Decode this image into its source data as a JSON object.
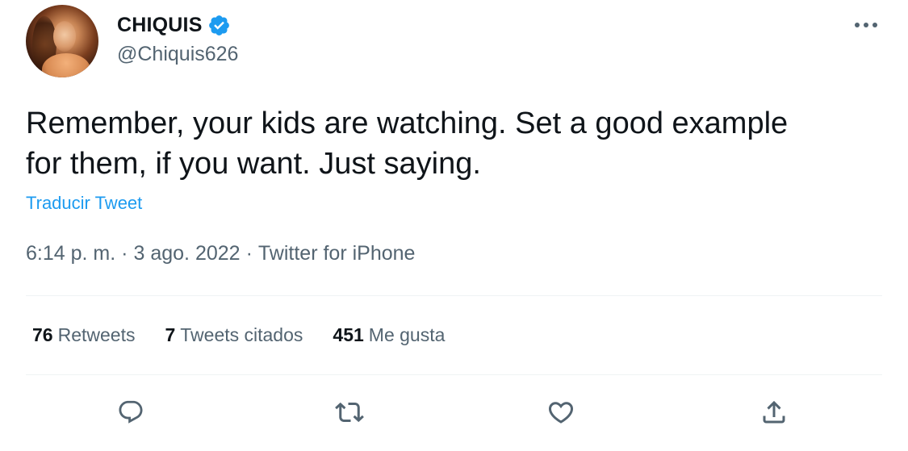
{
  "author": {
    "display_name": "CHIQUIS",
    "handle": "@Chiquis626",
    "verified": true,
    "avatar": "profile-photo"
  },
  "tweet": {
    "text": "Remember, your kids are watching. Set a good example\nfor them, if you want. Just saying.",
    "translate_label": "Traducir Tweet",
    "time": "6:14 p. m.",
    "separator": "·",
    "date": "3 ago. 2022",
    "source": "Twitter for iPhone"
  },
  "stats": {
    "retweets": {
      "count": "76",
      "label": "Retweets"
    },
    "quotes": {
      "count": "7",
      "label": "Tweets citados"
    },
    "likes": {
      "count": "451",
      "label": "Me gusta"
    }
  },
  "icons": {
    "more": "more-horizontal-icon",
    "reply": "reply-icon",
    "retweet": "retweet-icon",
    "like": "heart-icon",
    "share": "share-icon",
    "verified": "verified-badge-icon"
  },
  "colors": {
    "text_primary": "#0f1419",
    "text_secondary": "#536471",
    "accent": "#1d9bf0",
    "divider": "#eff3f4"
  }
}
